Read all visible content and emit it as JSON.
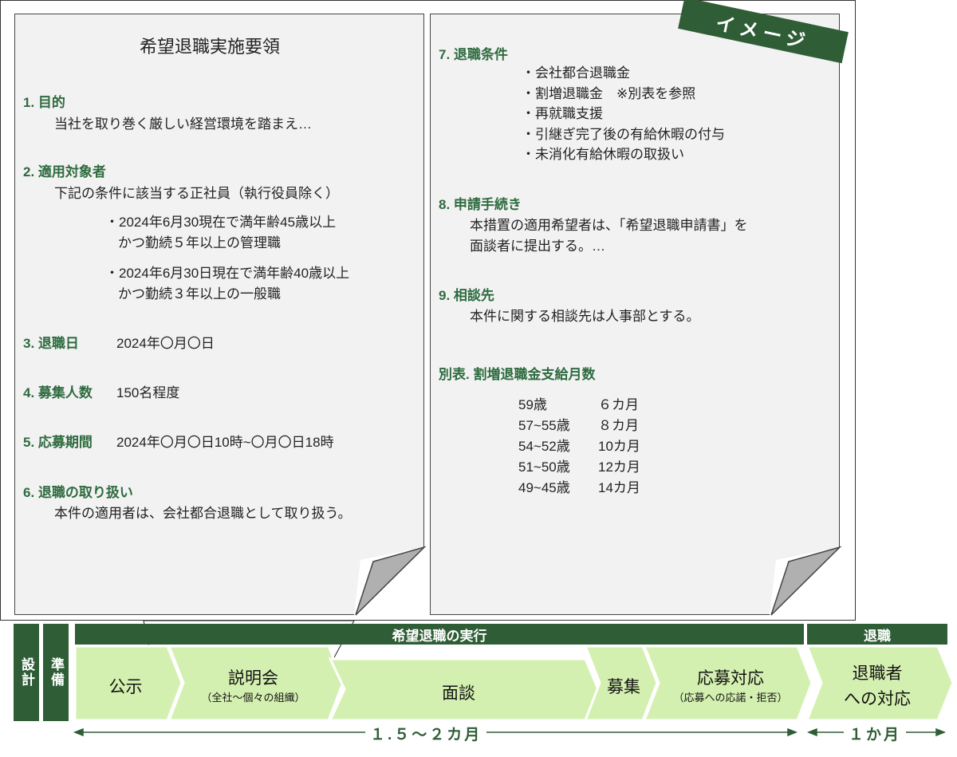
{
  "stamp": "イメージ",
  "left_doc": {
    "title": "希望退職実施要領",
    "s1": {
      "head": "1. 目的",
      "body": "当社を取り巻く厳しい経営環境を踏まえ…"
    },
    "s2": {
      "head": "2. 適用対象者",
      "body": "下記の条件に該当する正社員（執行役員除く）",
      "c1a": "・2024年6月30現在で満年齢45歳以上",
      "c1b": "かつ勤続５年以上の管理職",
      "c2a": "・2024年6月30日現在で満年齢40歳以上",
      "c2b": "かつ勤続３年以上の一般職"
    },
    "s3": {
      "head": "3. 退職日",
      "value": "2024年〇月〇日"
    },
    "s4": {
      "head": "4. 募集人数",
      "value": "150名程度"
    },
    "s5": {
      "head": "5. 応募期間",
      "value": "2024年〇月〇日10時~〇月〇日18時"
    },
    "s6": {
      "head": "6. 退職の取り扱い",
      "body": "本件の適用者は、会社都合退職として取り扱う。"
    }
  },
  "right_doc": {
    "s7": {
      "head": "7. 退職条件",
      "items": [
        "・会社都合退職金",
        "・割増退職金　※別表を参照",
        "・再就職支援",
        "・引継ぎ完了後の有給休暇の付与",
        "・未消化有給休暇の取扱い"
      ]
    },
    "s8": {
      "head": "8. 申請手続き",
      "body1": "本措置の適用希望者は、「希望退職申請書」を",
      "body2": "面談者に提出する。…"
    },
    "s9": {
      "head": "9. 相談先",
      "body": "本件に関する相談先は人事部とする。"
    },
    "table": {
      "head": "別表. 割増退職金支給月数",
      "rows": [
        {
          "age": "59歳",
          "months": "６カ月"
        },
        {
          "age": "57~55歳",
          "months": "８カ月"
        },
        {
          "age": "54~52歳",
          "months": "10カ月"
        },
        {
          "age": "51~50歳",
          "months": "12カ月"
        },
        {
          "age": "49~45歳",
          "months": "14カ月"
        }
      ]
    }
  },
  "timeline": {
    "design": "設計",
    "prep": "準備",
    "execution": "希望退職の実行",
    "retire": "退職",
    "steps": {
      "announce": "公示",
      "briefing": "説明会",
      "briefing_sub": "（全社～個々の組織）",
      "interview": "面談",
      "recruit": "募集",
      "response": "応募対応",
      "response_sub": "（応募への応諾・拒否）",
      "retiree1": "退職者",
      "retiree2": "への対応"
    },
    "period1": "１.５～２カ月",
    "period2": "１か月"
  },
  "colors": {
    "dark_green": "#2f5e36",
    "light_green": "#d4f0b0",
    "heading_green": "#2e6b3f",
    "sheet": "#f2f2f2"
  }
}
